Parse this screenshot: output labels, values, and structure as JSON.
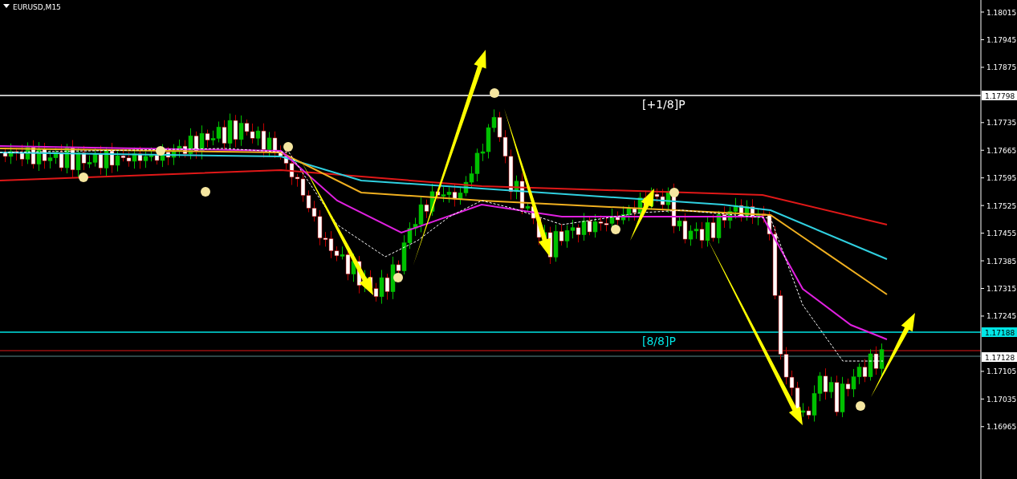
{
  "chart": {
    "title": "EURUSD,M15",
    "price_axis": [
      {
        "label": "1.18015"
      },
      {
        "label": "1.17945"
      },
      {
        "label": "1.17875"
      },
      {
        "label": "1.17735"
      },
      {
        "label": "1.17665"
      },
      {
        "label": "1.17595"
      },
      {
        "label": "1.17525"
      },
      {
        "label": "1.17455"
      },
      {
        "label": "1.17385"
      },
      {
        "label": "1.17315"
      },
      {
        "label": "1.17245"
      },
      {
        "label": "1.17105"
      },
      {
        "label": "1.17035"
      },
      {
        "label": "1.16965"
      }
    ],
    "levels": [
      {
        "label": "[+1/8]P",
        "price_label": "1.17798",
        "color": "#ffffff"
      },
      {
        "label": "[8/8]P",
        "price_label": "1.17188",
        "color": "#00e5e5"
      }
    ],
    "current_price": "1.17128"
  }
}
